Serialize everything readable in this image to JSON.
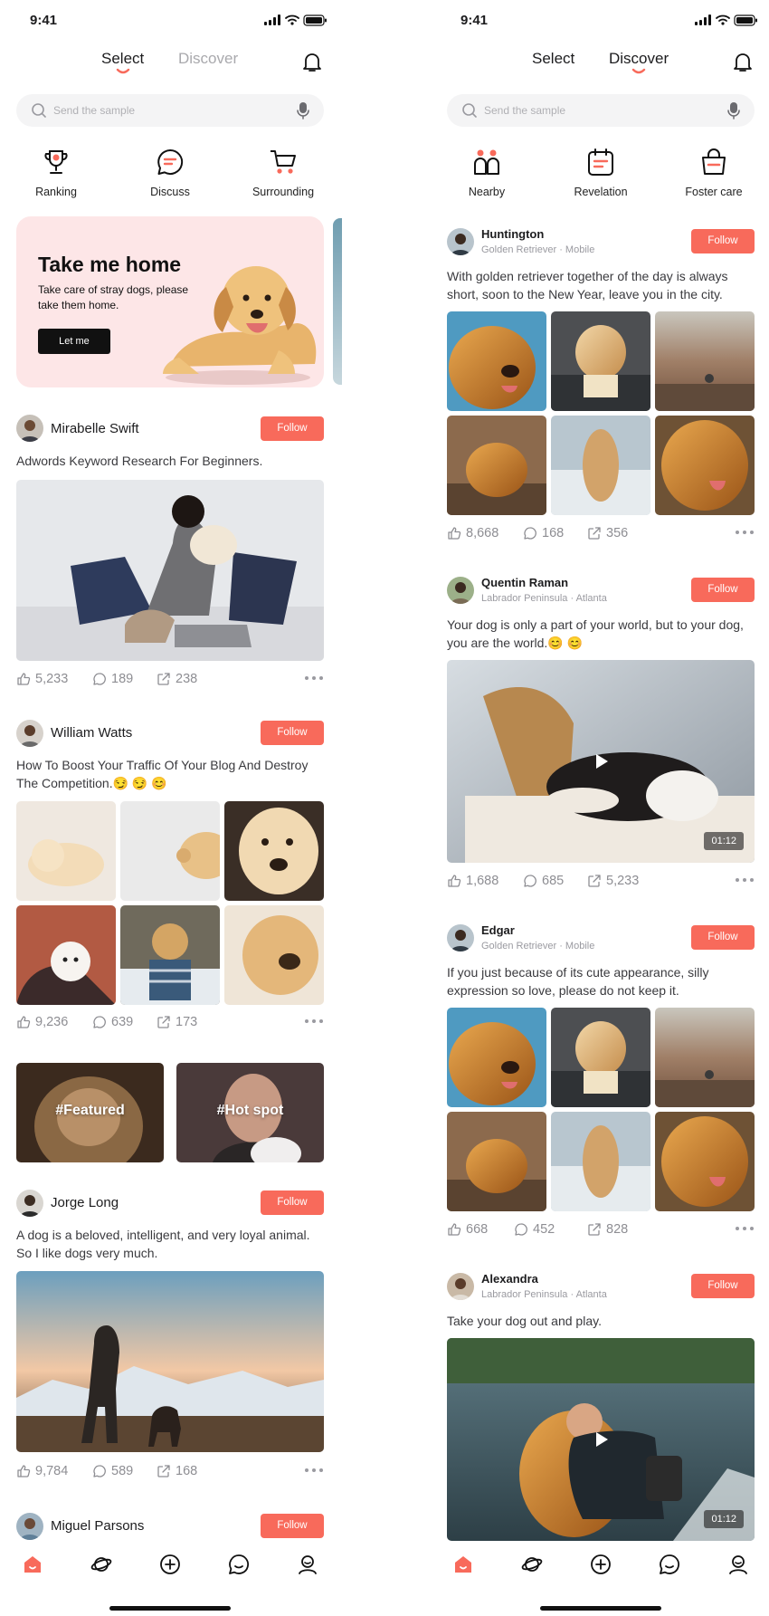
{
  "status_bar": {
    "time": "9:41"
  },
  "colors": {
    "accent": "#f86a5b",
    "banner_bg": "#fde6e7",
    "muted": "#9a9aa0"
  },
  "left": {
    "header": {
      "tab_select": "Select",
      "tab_discover": "Discover",
      "active": "Select"
    },
    "search": {
      "placeholder": "Send the sample"
    },
    "categories": [
      {
        "label": "Ranking",
        "icon": "trophy-icon"
      },
      {
        "label": "Discuss",
        "icon": "chat-icon"
      },
      {
        "label": "Surrounding",
        "icon": "cart-icon"
      }
    ],
    "banner": {
      "title": "Take me home",
      "description": "Take care of stray dogs, please take them home.",
      "button": "Let me"
    },
    "posts": [
      {
        "author": "Mirabelle Swift",
        "follow": "Follow",
        "text": "Adwords Keyword Research For Beginners.",
        "likes": "5,233",
        "comments": "189",
        "shares": "238"
      },
      {
        "author": "William Watts",
        "follow": "Follow",
        "text": "How To Boost Your Traffic Of Your Blog And Destroy The Competition.😏 😏 😊",
        "likes": "9,236",
        "comments": "639",
        "shares": "173"
      },
      {
        "author": "Jorge Long",
        "follow": "Follow",
        "text": "A dog is a beloved, intelligent, and very loyal animal. So I like dogs very much.",
        "likes": "9,784",
        "comments": "589",
        "shares": "168"
      },
      {
        "author": "Miguel Parsons",
        "follow": "Follow"
      }
    ],
    "tags": [
      "#Featured",
      "#Hot spot"
    ]
  },
  "right": {
    "header": {
      "tab_select": "Select",
      "tab_discover": "Discover",
      "active": "Discover"
    },
    "search": {
      "placeholder": "Send the sample"
    },
    "categories": [
      {
        "label": "Nearby",
        "icon": "people-icon"
      },
      {
        "label": "Revelation",
        "icon": "calendar-icon"
      },
      {
        "label": "Foster care",
        "icon": "basket-icon"
      }
    ],
    "posts": [
      {
        "author": "Huntington",
        "meta": "Golden Retriever · Mobile",
        "follow": "Follow",
        "text": "With golden retriever together of the day is always short, soon to the New Year, leave you in the city.",
        "likes": "8,668",
        "comments": "168",
        "shares": "356"
      },
      {
        "author": "Quentin Raman",
        "meta": "Labrador Peninsula · Atlanta",
        "follow": "Follow",
        "text": "Your dog is only a part of your world, but to your dog, you are the world.😊 😊",
        "duration": "01:12",
        "likes": "1,688",
        "comments": "685",
        "shares": "5,233"
      },
      {
        "author": "Edgar",
        "meta": "Golden Retriever · Mobile",
        "follow": "Follow",
        "text": "If you just because of its cute appearance, silly expression so love, please do not keep it.",
        "likes": "668",
        "comments": "452",
        "shares": "828"
      },
      {
        "author": "Alexandra",
        "meta": "Labrador Peninsula · Atlanta",
        "follow": "Follow",
        "text": "Take your dog out and play.",
        "duration": "01:12"
      }
    ]
  },
  "bottom_nav": [
    {
      "icon": "home-icon",
      "active": true
    },
    {
      "icon": "planet-icon",
      "active": false
    },
    {
      "icon": "plus-circle-icon",
      "active": false
    },
    {
      "icon": "message-icon",
      "active": false
    },
    {
      "icon": "profile-icon",
      "active": false
    }
  ]
}
